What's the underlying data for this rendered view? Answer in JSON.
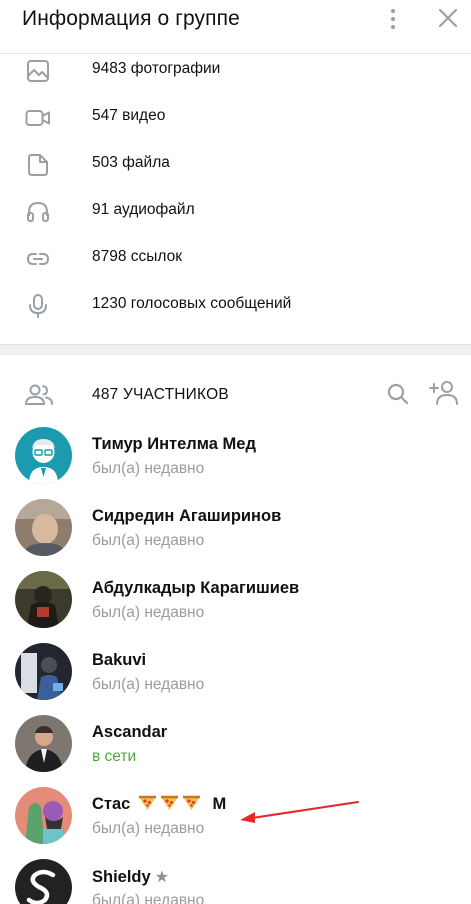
{
  "header": {
    "title": "Информация о группе"
  },
  "media": [
    {
      "label": "9483 фотографии",
      "icon": "photo-icon"
    },
    {
      "label": "547 видео",
      "icon": "video-icon"
    },
    {
      "label": "503 файла",
      "icon": "file-icon"
    },
    {
      "label": "91 аудиофайл",
      "icon": "headphones-icon"
    },
    {
      "label": "8798 ссылок",
      "icon": "link-icon"
    },
    {
      "label": "1230 голосовых сообщений",
      "icon": "microphone-icon"
    }
  ],
  "members": {
    "count_label": "487 УЧАСТНИКОВ",
    "list": [
      {
        "name": "Тимур Интелма Мед",
        "status": "был(а) недавно",
        "online": false
      },
      {
        "name": "Сидредин Агаширинов",
        "status": "был(а) недавно",
        "online": false
      },
      {
        "name": "Абдулкадыр Карагишиев",
        "status": "был(а) недавно",
        "online": false
      },
      {
        "name": "Bakuvi",
        "status": "был(а) недавно",
        "online": false
      },
      {
        "name": "Ascandar",
        "status": "в сети",
        "online": true
      },
      {
        "name": "Стас",
        "name_suffix": "M",
        "status": "был(а) недавно",
        "online": false
      },
      {
        "name": "Shieldy",
        "status": "был(а) недавно",
        "online": false
      }
    ]
  },
  "colors": {
    "online": "#4da838",
    "muted_text": "#9c9c9c",
    "icon_gray": "#9aa0a6",
    "annotation_arrow": "#e5262b"
  }
}
